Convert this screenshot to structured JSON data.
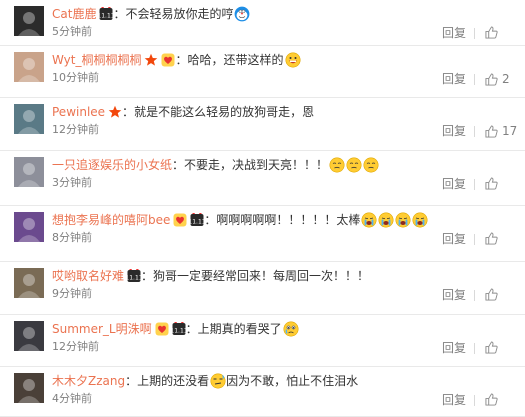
{
  "comments": [
    {
      "user": "Cat鹿鹿",
      "badges": [
        "vip-11-11-badge"
      ],
      "text": "不会轻易放你走的哼",
      "emojis": [
        "doraemon-emoji"
      ],
      "time": "5分钟前",
      "reply": "回复",
      "likes": "",
      "avatar_color": "#2b2b2b"
    },
    {
      "user": "Wyt_桐桐桐桐桐",
      "badges": [
        "verified-star-badge",
        "member-heart-badge"
      ],
      "text": "哈哈，还带这样的",
      "emojis": [
        "grin-emoji"
      ],
      "time": "10分钟前",
      "reply": "回复",
      "likes": "2",
      "avatar_color": "#c9a38a"
    },
    {
      "user": "Pewinlee",
      "badges": [
        "verified-star-badge"
      ],
      "text": "就是不能这么轻易的放狗哥走，恩",
      "emojis": [],
      "time": "12分钟前",
      "reply": "回复",
      "likes": "17",
      "avatar_color": "#5a7a86"
    },
    {
      "user": "一只追逐娱乐的小女纸",
      "badges": [],
      "text": "不要走，决战到天亮！！！",
      "emojis": [
        "sad-face-emoji",
        "sad-face-emoji",
        "sad-face-emoji"
      ],
      "time": "3分钟前",
      "reply": "回复",
      "likes": "",
      "avatar_color": "#8d8f9a"
    },
    {
      "user": "想抱李易峰的嘻阿bee",
      "badges": [
        "member-heart-badge",
        "vip-11-11-badge"
      ],
      "text": "啊啊啊啊啊！！！！！太棒",
      "emojis": [
        "cry-emoji",
        "cry-emoji",
        "cry-emoji",
        "cry-emoji"
      ],
      "time": "8分钟前",
      "reply": "回复",
      "likes": "",
      "avatar_color": "#6b4a8e"
    },
    {
      "user": "哎哟取名好难",
      "badges": [
        "vip-11-11-badge"
      ],
      "text": "狗哥一定要经常回来！每周回一次！！！",
      "emojis": [],
      "time": "9分钟前",
      "reply": "回复",
      "likes": "",
      "avatar_color": "#7a6b55"
    },
    {
      "user": "Summer_L明洙啊",
      "badges": [
        "member-heart-badge",
        "vip-11-11-badge"
      ],
      "text": "上期真的看哭了",
      "emojis": [
        "tears-emoji"
      ],
      "time": "12分钟前",
      "reply": "回复",
      "likes": "",
      "avatar_color": "#3a3a40"
    },
    {
      "user": "木木夕Zzang",
      "badges": [],
      "text": "上期的还没看",
      "text_after": "因为不敢，怕止不住泪水",
      "emojis": [
        "awkward-emoji"
      ],
      "time": "4分钟前",
      "reply": "回复",
      "likes": "",
      "avatar_color": "#4a4038"
    }
  ],
  "colors": {
    "username": "#eb7350",
    "time": "#808080",
    "text": "#333333",
    "divider": "#e9e9e9"
  }
}
